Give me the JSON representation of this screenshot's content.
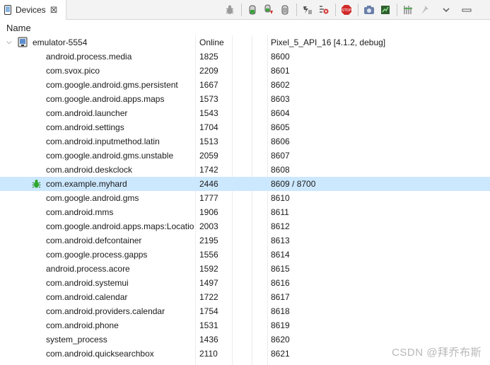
{
  "tab": {
    "label": "Devices",
    "close": "⊠"
  },
  "toolbar": {
    "buttons": [
      "debug-process",
      "update-heap",
      "update-threads",
      "dump-hprof",
      "cause-gc",
      "start-method-profiling",
      "stop-method-profiling",
      "stop-process",
      "screen-capture",
      "systrace",
      "reset-adb",
      "view-menu"
    ]
  },
  "table": {
    "header": {
      "name": "Name"
    },
    "device": {
      "name": "emulator-5554",
      "status": "Online",
      "avd": "Pixel_5_API_16 [4.1.2, debug]"
    },
    "processes": [
      {
        "name": "android.process.media",
        "pid": "1825",
        "port": "8600"
      },
      {
        "name": "com.svox.pico",
        "pid": "2209",
        "port": "8601"
      },
      {
        "name": "com.google.android.gms.persistent",
        "pid": "1667",
        "port": "8602"
      },
      {
        "name": "com.google.android.apps.maps",
        "pid": "1573",
        "port": "8603"
      },
      {
        "name": "com.android.launcher",
        "pid": "1543",
        "port": "8604"
      },
      {
        "name": "com.android.settings",
        "pid": "1704",
        "port": "8605"
      },
      {
        "name": "com.android.inputmethod.latin",
        "pid": "1513",
        "port": "8606"
      },
      {
        "name": "com.google.android.gms.unstable",
        "pid": "2059",
        "port": "8607"
      },
      {
        "name": "com.android.deskclock",
        "pid": "1742",
        "port": "8608"
      },
      {
        "name": "com.example.myhard",
        "pid": "2446",
        "port": "8609 / 8700"
      },
      {
        "name": "com.google.android.gms",
        "pid": "1777",
        "port": "8610"
      },
      {
        "name": "com.android.mms",
        "pid": "1906",
        "port": "8611"
      },
      {
        "name": "com.google.android.apps.maps:LocationFriendService",
        "pid": "2003",
        "port": "8612"
      },
      {
        "name": "com.android.defcontainer",
        "pid": "2195",
        "port": "8613"
      },
      {
        "name": "com.google.process.gapps",
        "pid": "1556",
        "port": "8614"
      },
      {
        "name": "android.process.acore",
        "pid": "1592",
        "port": "8615"
      },
      {
        "name": "com.android.systemui",
        "pid": "1497",
        "port": "8616"
      },
      {
        "name": "com.android.calendar",
        "pid": "1722",
        "port": "8617"
      },
      {
        "name": "com.android.providers.calendar",
        "pid": "1754",
        "port": "8618"
      },
      {
        "name": "com.android.phone",
        "pid": "1531",
        "port": "8619"
      },
      {
        "name": "system_process",
        "pid": "1436",
        "port": "8620"
      },
      {
        "name": "com.android.quicksearchbox",
        "pid": "2110",
        "port": "8621"
      }
    ]
  },
  "watermark": "CSDN @拜乔布斯"
}
